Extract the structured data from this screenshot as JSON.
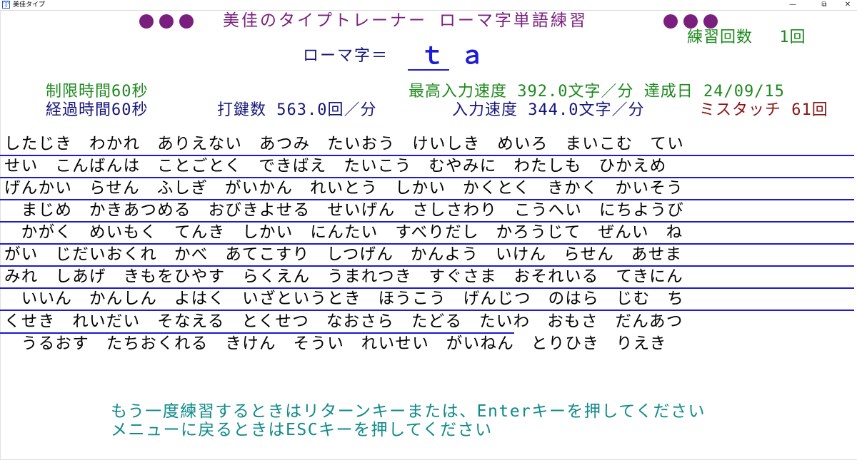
{
  "window": {
    "icon_text": "HWタイ",
    "title": "美佳タイプ",
    "minimize": "—",
    "maximize": "⧉",
    "close": "✕"
  },
  "header": {
    "title": "美佳のタイプトレーナー ローマ字単語練習",
    "practice_count": "練習回数　 1回"
  },
  "romaji": {
    "label": "ローマ字＝",
    "typed": "ｔ",
    "next": "ａ"
  },
  "stats": {
    "time_limit": "制限時間60秒",
    "elapsed": "経過時間60秒",
    "keystrokes": "打鍵数 563.0回／分",
    "best_speed": "最高入力速度 392.0文字／分 達成日 24/09/15",
    "speed": "入力速度 344.0文字／分",
    "mistouch": "ミスタッチ 61回"
  },
  "word_rows": [
    "したじき　わかれ　ありえない　あつみ　たいおう　けいしき　めいろ　まいこむ　てい",
    "せい　こんばんは　ことごとく　できばえ　たいこう　むやみに　わたしも　ひかえめ",
    "げんかい　らせん　ふしぎ　がいかん　れいとう　しかい　かくとく　きかく　かいそう",
    "　まじめ　かきあつめる　おびきよせる　せいげん　さしさわり　こうへい　にちようび",
    "　かがく　めいもく　てんき　しかい　にんたい　すべりだし　かろうじて　ぜんい　ね",
    "がい　じだいおくれ　かべ　あてこすり　しつげん　かんよう　いけん　らせん　あせま",
    "みれ　しあげ　きもをひやす　らくえん　うまれつき　すぐさま　おそれいる　てきにん",
    "　いいん　かんしん　よはく　いざというとき　ほうこう　げんじつ　のはら　じむ　ち",
    "くせき　れいだい　そなえる　とくせつ　なおさら　たどる　たいわ　おもさ　だんあつ",
    "　うるおす　たちおくれる　きけん　そうい　れいせい　がいねん　とりひき　りえき"
  ],
  "footer": {
    "line1": "もう一度練習するときはリターンキーまたは、Enterキーを押してください",
    "line2": "メニューに戻るときはESCキーを押してください"
  }
}
